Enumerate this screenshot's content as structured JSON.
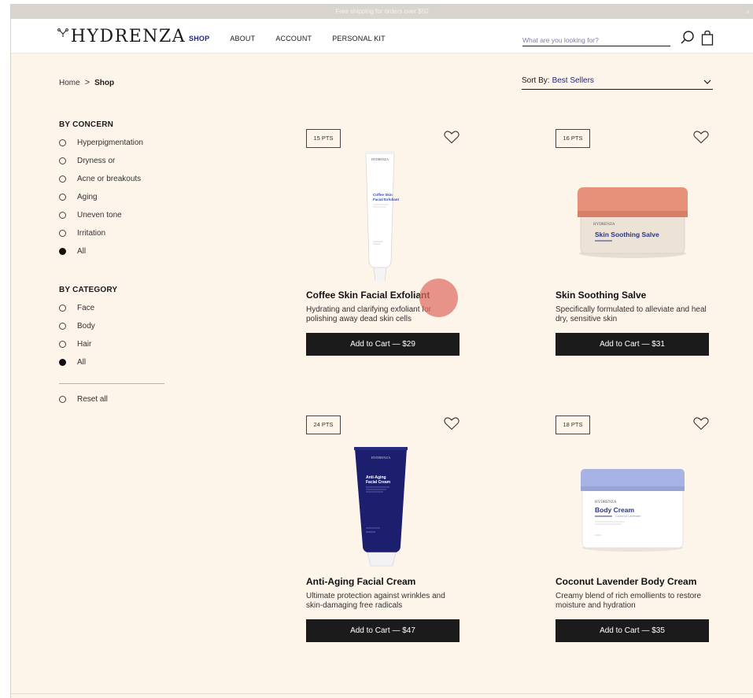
{
  "promo": {
    "text": "Free shipping for orders over $50",
    "close": "×"
  },
  "header": {
    "logo": "HYDRENZA",
    "nav": [
      {
        "label": "SHOP",
        "active": true
      },
      {
        "label": "ABOUT"
      },
      {
        "label": "ACCOUNT"
      },
      {
        "label": "PERSONAL KIT"
      }
    ],
    "search_placeholder": "What are you looking for?",
    "icons": [
      "search-icon",
      "shopping-bag-icon"
    ]
  },
  "breadcrumb": {
    "home": "Home",
    "separator": ">",
    "current": "Shop"
  },
  "sort": {
    "label": "Sort By:",
    "value": "Best Sellers"
  },
  "filters": {
    "concern": {
      "title": "BY CONCERN",
      "options": [
        {
          "label": "Hyperpigmentation",
          "selected": false
        },
        {
          "label": "Dryness or",
          "selected": false
        },
        {
          "label": "Acne or breakouts",
          "selected": false
        },
        {
          "label": "Aging",
          "selected": false
        },
        {
          "label": "Uneven tone",
          "selected": false
        },
        {
          "label": "Irritation",
          "selected": false
        },
        {
          "label": "All",
          "selected": true
        }
      ]
    },
    "category": {
      "title": "BY CATEGORY",
      "options": [
        {
          "label": "Face",
          "selected": false
        },
        {
          "label": "Body",
          "selected": false
        },
        {
          "label": "Hair",
          "selected": false
        },
        {
          "label": "All",
          "selected": true
        }
      ]
    },
    "reset": "Reset all"
  },
  "products": [
    {
      "points": "15 PTS",
      "name": "Coffee Skin Facial Exfoliant",
      "description": "Hydrating and clarifying exfoliant for polishing away dead skin cells",
      "cart_label": "Add to Cart — $29",
      "image": {
        "brand": "HYDRENZA",
        "label_line1": "Coffee Skin",
        "label_line2": "Facial Exfoliant"
      }
    },
    {
      "points": "16 PTS",
      "name": "Skin Soothing Salve",
      "description": "Specifically formulated to alleviate and heal dry, sensitive skin",
      "cart_label": "Add to Cart — $31",
      "image": {
        "brand": "HYDRENZA",
        "label_line1": "Skin Soothing Salve"
      }
    },
    {
      "points": "24 PTS",
      "name": "Anti-Aging Facial Cream",
      "description": "Ultimate protection against wrinkles and skin-damaging free radicals",
      "cart_label": "Add to Cart — $47",
      "image": {
        "brand": "HYDRENZA",
        "label_line1": "Anti-Aging",
        "label_line2": "Facial Cream"
      }
    },
    {
      "points": "18 PTS",
      "name": "Coconut Lavender Body Cream",
      "description": "Creamy blend of rich emollients to restore moisture and hydration",
      "cart_label": "Add to Cart — $35",
      "image": {
        "brand": "HYDRENZA",
        "label_line1": "Body Cream",
        "label_line2": "Coconut Lavender"
      }
    }
  ],
  "colors": {
    "page_bg": "#fdf4ea",
    "accent_navy": "#1f2a7a",
    "button_bg": "#1b1b1b",
    "salve_lid": "#e8917a",
    "body_cream_lid": "#a7b3e4",
    "anti_aging_tube": "#1c1e6e"
  }
}
